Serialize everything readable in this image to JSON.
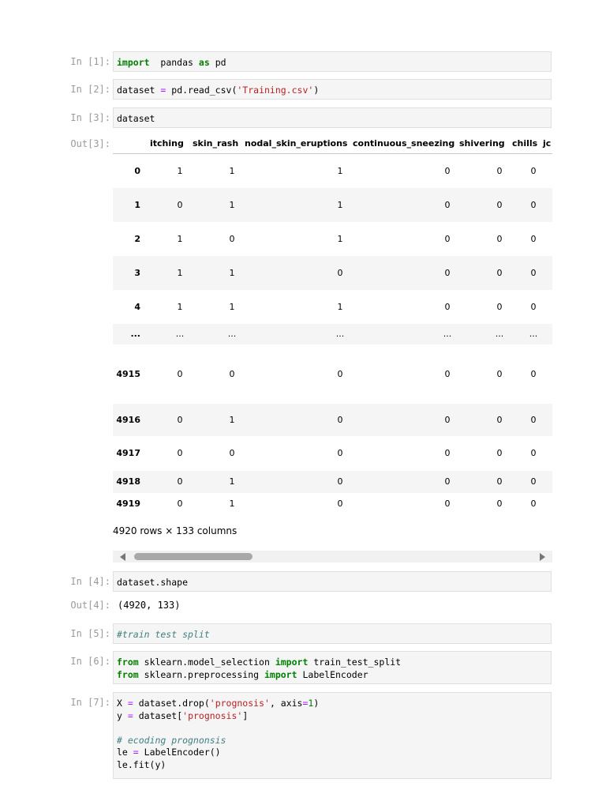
{
  "cells": {
    "c1": {
      "prompt": "In [1]:",
      "code": [
        "import",
        "pandas",
        "as",
        "pd"
      ]
    },
    "c2": {
      "prompt": "In [2]:",
      "var": "dataset",
      "eq": "=",
      "call": "pd.read_csv(",
      "arg": "'Training.csv'",
      "close": ")"
    },
    "c3": {
      "prompt": "In [3]:",
      "code": "dataset",
      "out_prompt": "Out[3]:"
    },
    "c4": {
      "prompt": "In [4]:",
      "code": "dataset.shape",
      "out_prompt": "Out[4]:",
      "output": "(4920, 133)"
    },
    "c5": {
      "prompt": "In [5]:",
      "comment": "#train test split"
    },
    "c6": {
      "prompt": "In [6]:",
      "line1": {
        "from": "from",
        "mod": "sklearn.model_selection",
        "imp": "import",
        "name": "train_test_split"
      },
      "line2": {
        "from": "from",
        "mod": "sklearn.preprocessing",
        "imp": "import",
        "name": "LabelEncoder"
      }
    },
    "c7": {
      "prompt": "In [7]:",
      "l1": {
        "a": "X",
        "eq": "=",
        "b": "dataset.drop(",
        "s": "'prognosis'",
        "c": ", axis",
        "e": "=",
        "n": "1",
        "d": ")"
      },
      "l2": {
        "a": "y",
        "eq": "=",
        "b": "dataset[",
        "s": "'prognosis'",
        "d": "]"
      },
      "l3": "# ecoding prognonsis",
      "l4": {
        "a": "le",
        "eq": "=",
        "b": "LabelEncoder()"
      },
      "l5": "le.fit(y)"
    }
  },
  "dataframe": {
    "columns": [
      "itching",
      "skin_rash",
      "nodal_skin_eruptions",
      "continuous_sneezing",
      "shivering",
      "chills",
      "jc"
    ],
    "rows": [
      {
        "index": "0",
        "values": [
          "1",
          "1",
          "1",
          "0",
          "0",
          "0"
        ]
      },
      {
        "index": "1",
        "values": [
          "0",
          "1",
          "1",
          "0",
          "0",
          "0"
        ]
      },
      {
        "index": "2",
        "values": [
          "1",
          "0",
          "1",
          "0",
          "0",
          "0"
        ]
      },
      {
        "index": "3",
        "values": [
          "1",
          "1",
          "0",
          "0",
          "0",
          "0"
        ]
      },
      {
        "index": "4",
        "values": [
          "1",
          "1",
          "1",
          "0",
          "0",
          "0"
        ]
      },
      {
        "index": "...",
        "values": [
          "...",
          "...",
          "...",
          "...",
          "...",
          "..."
        ]
      },
      {
        "index": "4915",
        "values": [
          "0",
          "0",
          "0",
          "0",
          "0",
          "0"
        ]
      },
      {
        "index": "4916",
        "values": [
          "0",
          "1",
          "0",
          "0",
          "0",
          "0"
        ]
      },
      {
        "index": "4917",
        "values": [
          "0",
          "0",
          "0",
          "0",
          "0",
          "0"
        ]
      },
      {
        "index": "4918",
        "values": [
          "0",
          "1",
          "0",
          "0",
          "0",
          "0"
        ]
      },
      {
        "index": "4919",
        "values": [
          "0",
          "1",
          "0",
          "0",
          "0",
          "0"
        ]
      }
    ],
    "summary": "4920 rows × 133 columns"
  }
}
